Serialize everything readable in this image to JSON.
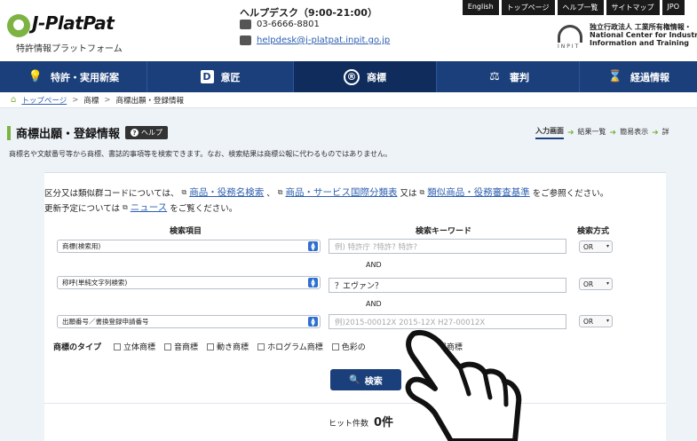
{
  "header": {
    "logo_text": "J-PlatPat",
    "logo_subtitle": "特許情報プラットフォーム",
    "helpdesk_label": "ヘルプデスク（9:00-21:00）",
    "phone": "03-6666-8801",
    "email": "helpdesk@j-platpat.inpit.go.jp",
    "top_links": [
      "English",
      "トップページ",
      "ヘルプ一覧",
      "サイトマップ",
      "JPO"
    ],
    "org_logo_label": "INPIT",
    "org_name_jp": "独立行政法人 工業所有権情報・",
    "org_name_en1": "National Center for Industrial P",
    "org_name_en2": "Information and Training"
  },
  "nav": [
    {
      "label": "特許・実用新案",
      "icon": "lightbulb-icon",
      "glyph": "💡"
    },
    {
      "label": "意匠",
      "icon": "design-d-icon",
      "glyph": "D"
    },
    {
      "label": "商標",
      "icon": "registered-icon",
      "glyph": "®"
    },
    {
      "label": "審判",
      "icon": "gavel-icon",
      "glyph": "⚖"
    },
    {
      "label": "経過情報",
      "icon": "hourglass-icon",
      "glyph": "⌛"
    }
  ],
  "breadcrumb": {
    "home": "トップページ",
    "level2": "商標",
    "level3": "商標出願・登録情報"
  },
  "page": {
    "title": "商標出願・登録情報",
    "help_label": "ヘルプ",
    "steps": [
      "入力画面",
      "結果一覧",
      "簡易表示",
      "詳"
    ],
    "description": "商標名や文献番号等から商標、書誌的事項等を検索できます。なお、検索結果は商標公報に代わるものではありません。"
  },
  "info": {
    "line1_prefix": "区分又は類似群コードについては、",
    "link1": "商品・役務名検索",
    "sep1": "、",
    "link2": "商品・サービス国際分類表",
    "sep2": "又は",
    "link3": "類似商品・役務審査基準",
    "line1_suffix": "をご参照ください。",
    "line2_prefix": "更新予定については",
    "link4": "ニュース",
    "line2_suffix": "をご覧ください。"
  },
  "form": {
    "col_item": "検索項目",
    "col_keyword": "検索キーワード",
    "col_method": "検索方式",
    "and_label": "AND",
    "rows": [
      {
        "item": "商標(検索用)",
        "keyword_value": "",
        "keyword_placeholder": "例) 特許庁 ?特許? 特許?",
        "method": "OR"
      },
      {
        "item": "称呼(単純文字列検索)",
        "keyword_value": "？エヴァン？",
        "keyword_placeholder": "",
        "method": "OR"
      },
      {
        "item": "出願番号／書換登録申請番号",
        "keyword_value": "",
        "keyword_placeholder": "例)2015-00012X 2015-12X H27-00012X",
        "method": "OR"
      }
    ],
    "type_label": "商標のタイプ",
    "types": [
      "立体商標",
      "音商標",
      "動き商標",
      "ホログラム商標",
      "色彩の",
      "位置商標"
    ],
    "search_label": "検索",
    "hits_label": "ヒット件数",
    "hits_value": "0件"
  }
}
